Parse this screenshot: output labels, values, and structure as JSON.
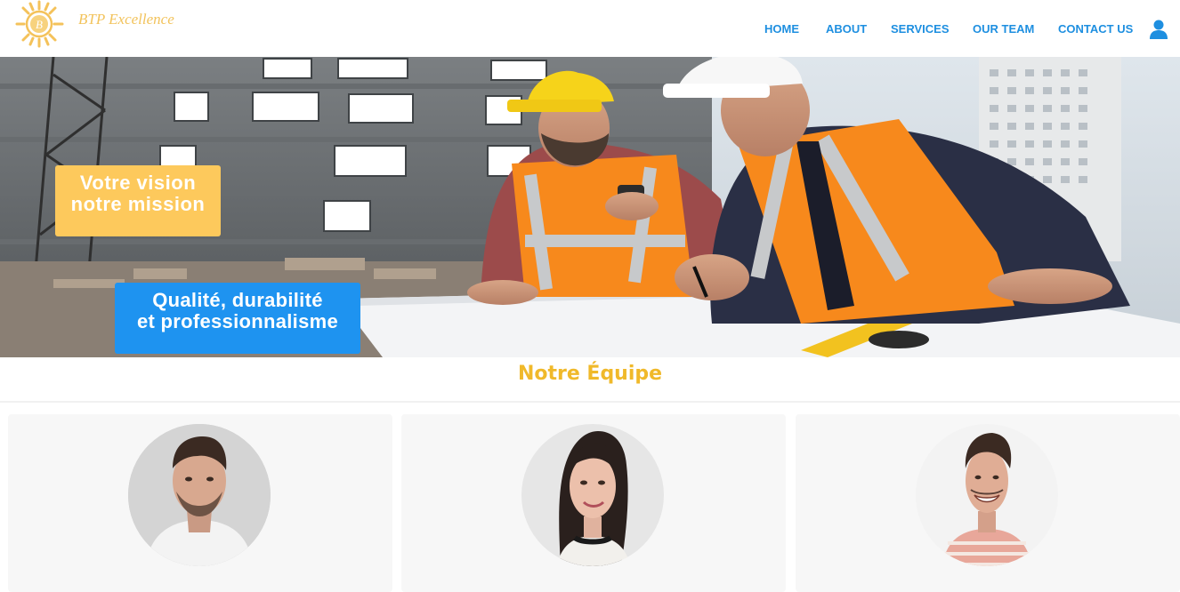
{
  "brand": {
    "name": "BTP Excellence",
    "accent": "#f2c35c"
  },
  "nav": {
    "items": [
      {
        "label": "HOME"
      },
      {
        "label": "ABOUT"
      },
      {
        "label": "SERVICES"
      },
      {
        "label": "OUR TEAM"
      },
      {
        "label": "CONTACT US"
      }
    ],
    "color": "#1e8fe0",
    "user_icon": "user-icon"
  },
  "hero": {
    "image": "construction-workers-reviewing-plans",
    "badge_primary": {
      "line1": "Votre vision",
      "line2": "notre mission",
      "color": "#fdc95c"
    },
    "badge_secondary": {
      "line1": "Qualité, durabilité",
      "line2": "et professionnalisme",
      "color": "#1e93f0"
    }
  },
  "team": {
    "title": "Notre Équipe",
    "title_color": "#f0b92a",
    "members": [
      {
        "photo": "man-white-shirt-portrait"
      },
      {
        "photo": "woman-dark-hair-portrait"
      },
      {
        "photo": "man-striped-shirt-portrait"
      }
    ]
  }
}
